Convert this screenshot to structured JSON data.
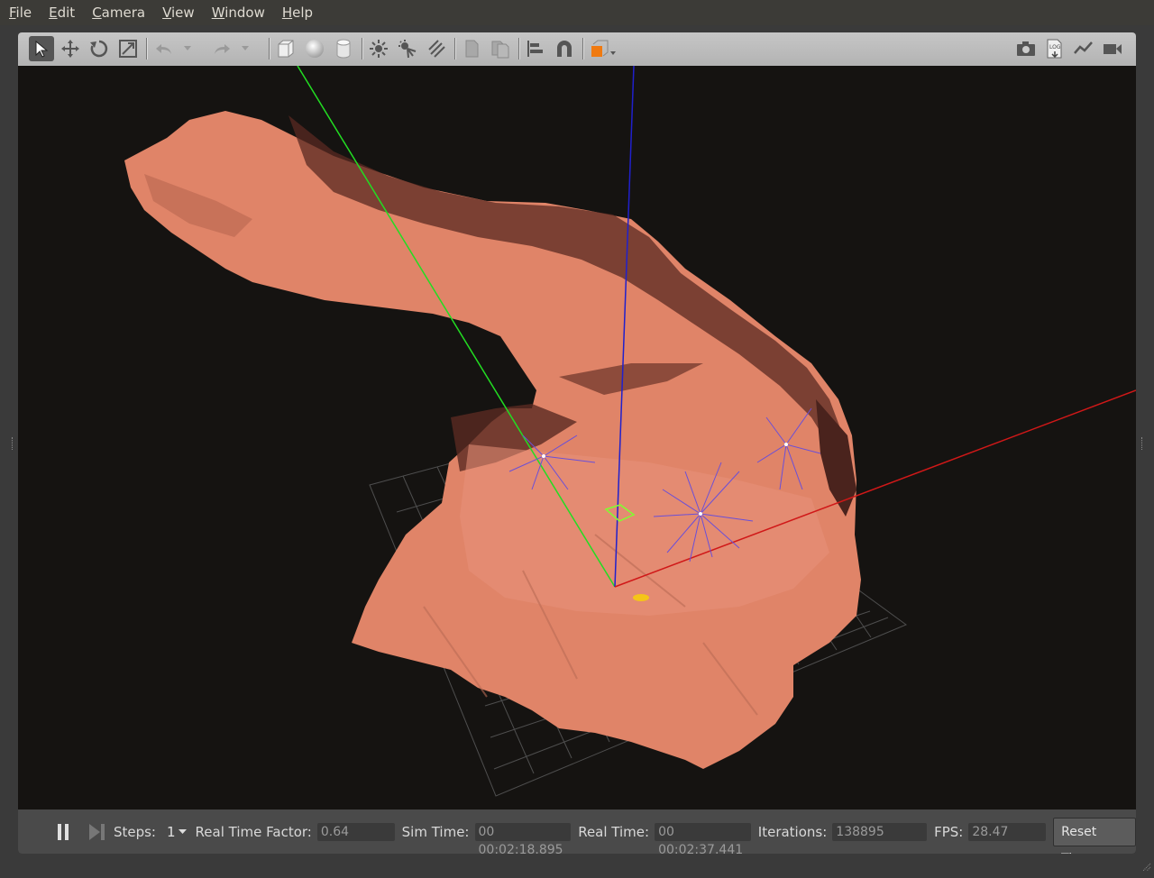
{
  "menu": [
    "File",
    "Edit",
    "Camera",
    "View",
    "Window",
    "Help"
  ],
  "menu_mnemonic": [
    "F",
    "E",
    "C",
    "V",
    "W",
    "H"
  ],
  "toolbar": {
    "left_tools": [
      "select-arrow-icon",
      "translate-icon",
      "rotate-icon",
      "scale-icon",
      "undo-icon",
      "undo-dropdown-icon",
      "redo-icon",
      "redo-dropdown-icon",
      "box-shape-icon",
      "sphere-shape-icon",
      "cylinder-shape-icon",
      "point-light-icon",
      "spot-light-icon",
      "directional-light-icon",
      "copy-icon",
      "paste-icon",
      "align-icon",
      "snap-magnet-icon",
      "view-angle-icon"
    ],
    "right_tools": [
      "screenshot-camera-icon",
      "log-icon",
      "plot-icon",
      "video-record-icon"
    ]
  },
  "bottom": {
    "steps_label": "Steps:",
    "steps_value": "1",
    "rtf_label": "Real Time Factor:",
    "rtf_value": "0.64",
    "sim_label": "Sim Time:",
    "sim_value": "00 00:02:18.895",
    "real_label": "Real Time:",
    "real_value": "00 00:02:37.441",
    "iter_label": "Iterations:",
    "iter_value": "138895",
    "fps_label": "FPS:",
    "fps_value": "28.47",
    "reset_label": "Reset Time"
  },
  "colors": {
    "terrain": "#e08468",
    "terrain_shadow": "#5a2a22",
    "x_axis": "#d01818",
    "y_axis": "#22dd22",
    "z_axis": "#2020cc",
    "grid": "#505050",
    "light_rays": "#6a4fd8",
    "selection": "#7fff30",
    "marker": "#f5c518"
  }
}
